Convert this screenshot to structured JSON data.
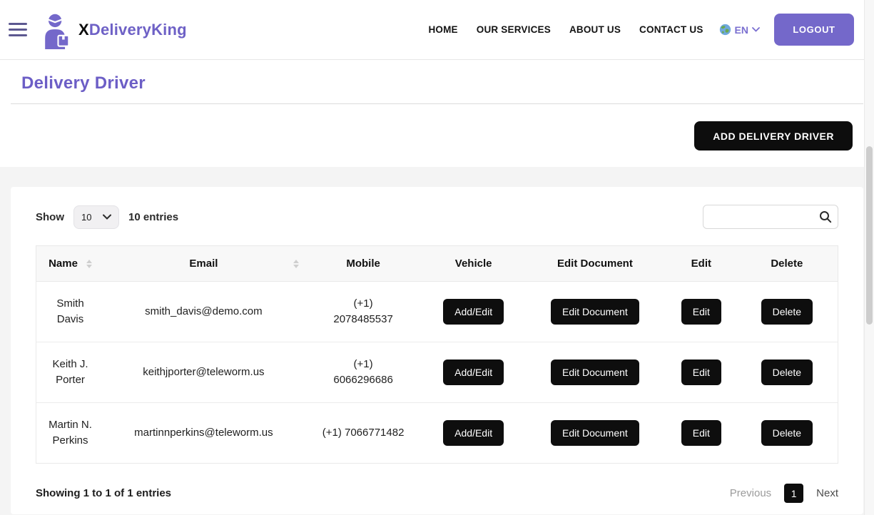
{
  "brand": {
    "prefix": "X",
    "name": "DeliveryKing"
  },
  "nav": {
    "links": [
      {
        "label": "HOME"
      },
      {
        "label": "OUR SERVICES"
      },
      {
        "label": "ABOUT US"
      },
      {
        "label": "CONTACT US"
      }
    ],
    "language_code": "EN",
    "logout_label": "LOGOUT"
  },
  "page": {
    "title": "Delivery Driver",
    "add_button_label": "ADD DELIVERY DRIVER"
  },
  "controls": {
    "show_label": "Show",
    "page_size": "10",
    "entries_summary": "10 entries",
    "search_value": ""
  },
  "table": {
    "headers": [
      "Name",
      "Email",
      "Mobile",
      "Vehicle",
      "Edit Document",
      "Edit",
      "Delete"
    ],
    "actions": {
      "vehicle": "Add/Edit",
      "document": "Edit Document",
      "edit": "Edit",
      "delete": "Delete"
    },
    "rows": [
      {
        "name": "Smith\nDavis",
        "email": "smith_davis@demo.com",
        "mobile": "(+1)\n2078485537"
      },
      {
        "name": "Keith J.\nPorter",
        "email": "keithjporter@teleworm.us",
        "mobile": "(+1)\n6066296686"
      },
      {
        "name": "Martin N.\nPerkins",
        "email": "martinnperkins@teleworm.us",
        "mobile": "(+1) 7066771482"
      }
    ]
  },
  "footer": {
    "summary": "Showing 1 to 1 of 1 entries",
    "previous_label": "Previous",
    "current_page": "1",
    "next_label": "Next"
  },
  "colors": {
    "brand_purple": "#6e61c6",
    "logout_purple": "#7468ca",
    "action_black": "#0d0d0d",
    "header_bg": "#f8f8f8",
    "page_bg": "#f4f4f4"
  }
}
